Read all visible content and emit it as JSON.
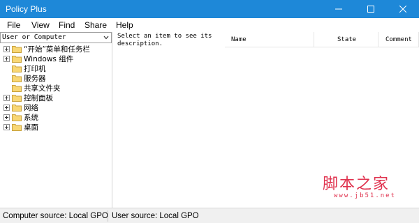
{
  "window": {
    "title": "Policy Plus",
    "title_bar_color": "#1e88d8"
  },
  "menu": [
    {
      "label": "File"
    },
    {
      "label": "View"
    },
    {
      "label": "Find"
    },
    {
      "label": "Share"
    },
    {
      "label": "Help"
    }
  ],
  "left_pane": {
    "scope_selector": {
      "value": "User or Computer"
    },
    "tree": [
      {
        "label": "“开始”菜单和任务栏",
        "expandable": true
      },
      {
        "label": "Windows 组件",
        "expandable": true
      },
      {
        "label": "打印机",
        "expandable": false
      },
      {
        "label": "服务器",
        "expandable": false
      },
      {
        "label": "共享文件夹",
        "expandable": false
      },
      {
        "label": "控制面板",
        "expandable": true
      },
      {
        "label": "网络",
        "expandable": true
      },
      {
        "label": "系统",
        "expandable": true
      },
      {
        "label": "桌面",
        "expandable": true
      }
    ]
  },
  "description_pane": {
    "text": "Select an item to see its description."
  },
  "settings_list": {
    "columns": [
      {
        "label": "Name"
      },
      {
        "label": "State"
      },
      {
        "label": "Comment"
      }
    ]
  },
  "status_bar": {
    "computer_source": "Computer source:  Local GPO",
    "user_source": "User source:  Local GPO"
  },
  "watermark": {
    "main": "脚本之家",
    "url": "www.jb51.net"
  }
}
